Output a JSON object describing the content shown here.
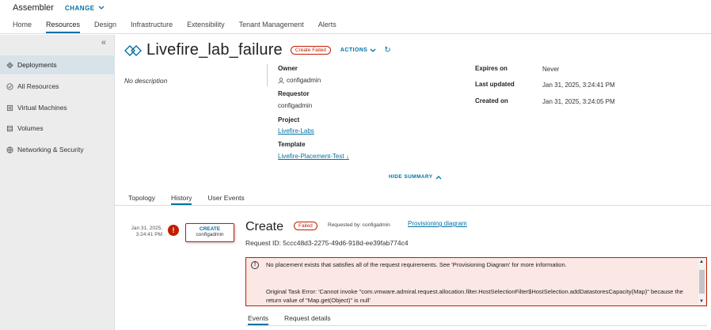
{
  "app": {
    "title": "Assembler",
    "change_label": "CHANGE"
  },
  "nav": {
    "tabs": [
      "Home",
      "Resources",
      "Design",
      "Infrastructure",
      "Extensibility",
      "Tenant Management",
      "Alerts"
    ],
    "active": "Resources"
  },
  "sidebar": {
    "collapse_glyph": "«",
    "items": [
      {
        "label": "Deployments",
        "icon": "deployments-icon",
        "active": true
      },
      {
        "label": "All Resources",
        "icon": "all-resources-icon"
      },
      {
        "label": "Virtual Machines",
        "icon": "virtual-machines-icon"
      },
      {
        "label": "Volumes",
        "icon": "volumes-icon"
      },
      {
        "label": "Networking & Security",
        "icon": "networking-icon"
      }
    ]
  },
  "deployment": {
    "name": "Livefire_lab_failure",
    "status": "Create Failed",
    "actions_label": "ACTIONS",
    "description": "No description",
    "owner_label": "Owner",
    "owner": "configadmin",
    "requestor_label": "Requestor",
    "requestor": "configadmin",
    "project_label": "Project",
    "project": "Livefire-Labs",
    "template_label": "Template",
    "template": "Livefire-Placement-Test",
    "expires_label": "Expires on",
    "expires": "Never",
    "updated_label": "Last updated",
    "updated": "Jan 31, 2025, 3:24:41 PM",
    "created_label": "Created on",
    "created": "Jan 31, 2025, 3:24:05 PM",
    "hide_summary": "HIDE SUMMARY"
  },
  "tabs": [
    "Topology",
    "History",
    "User Events"
  ],
  "history": {
    "date_line1": "Jan 31, 2025,",
    "date_line2": "3:24:41 PM",
    "box_title": "CREATE",
    "box_user": "configadmin",
    "title": "Create",
    "status": "Failed",
    "requested_by": "Requested by: configadmin",
    "diagram_link": "Provisioning diagram",
    "request_id": "Request ID: 5ccc48d3-2275-49d6-918d-ee39fab774c4",
    "error_message": "No placement exists that satisfies all of the request requirements. See 'Provisioning Diagram' for more information.",
    "error_original": "Original Task Error: 'Cannot invoke \"com.vmware.admiral.request.allocation.filter.HostSelectionFilter$HostSelection.addDatastoresCapacity(Map)\" because the return value of \"Map.get(Object)\" is null'"
  },
  "subtabs": [
    "Events",
    "Request details"
  ],
  "colors": {
    "accent": "#0072a3",
    "error": "#c21d00",
    "error_bg": "#fbe7e4",
    "sidebar_bg": "#ececec",
    "sidebar_active": "#d8e3e9"
  }
}
